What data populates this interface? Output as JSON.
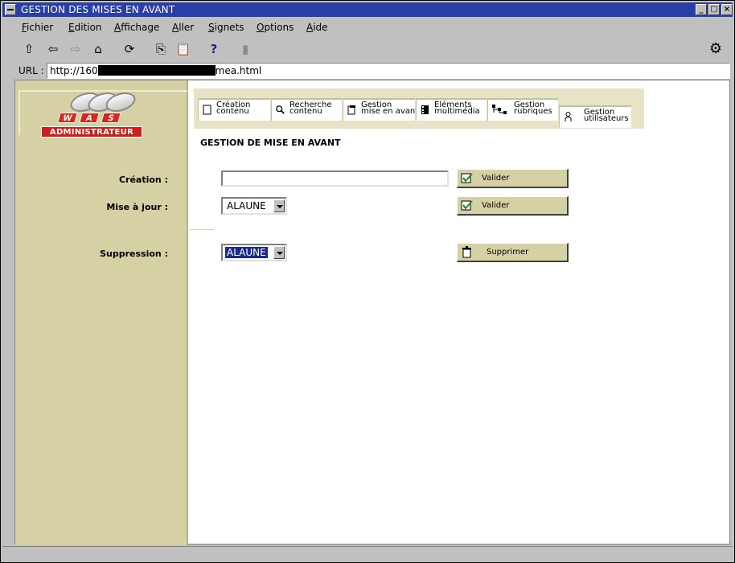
{
  "window": {
    "title": "GESTION DES MISES EN AVANT"
  },
  "menu": {
    "items": [
      "Fichier",
      "Edition",
      "Affichage",
      "Aller",
      "Signets",
      "Options",
      "Aide"
    ]
  },
  "url": {
    "label": "URL :",
    "value_start": "http://160",
    "value_end": "mea.html"
  },
  "logo": {
    "letters": [
      "W",
      "A",
      "S"
    ],
    "badge": "ADMINISTRATEUR"
  },
  "tabs": [
    {
      "line1": "Création",
      "line2": "contenu",
      "icon": "page-icon"
    },
    {
      "line1": "Recherche",
      "line2": "contenu",
      "icon": "magnifier-icon"
    },
    {
      "line1": "Gestion",
      "line2": "mise en avant",
      "icon": "document-star-icon"
    },
    {
      "line1": "Eléments",
      "line2": "multimédia",
      "icon": "film-icon"
    },
    {
      "line1": "Gestion",
      "line2": "rubriques",
      "icon": "tree-icon"
    },
    {
      "line1": "Gestion",
      "line2": "utilisateurs",
      "icon": "user-icon"
    }
  ],
  "form": {
    "title": "GESTION DE MISE EN AVANT",
    "creation_label": "Création :",
    "creation_value": "",
    "update_label": "Mise à jour :",
    "update_value": "ALAUNE",
    "delete_label": "Suppression :",
    "delete_value": "ALAUNE",
    "validate_label": "Valider",
    "validate2_label": "Valider",
    "delete_button_label": "Supprimer"
  }
}
